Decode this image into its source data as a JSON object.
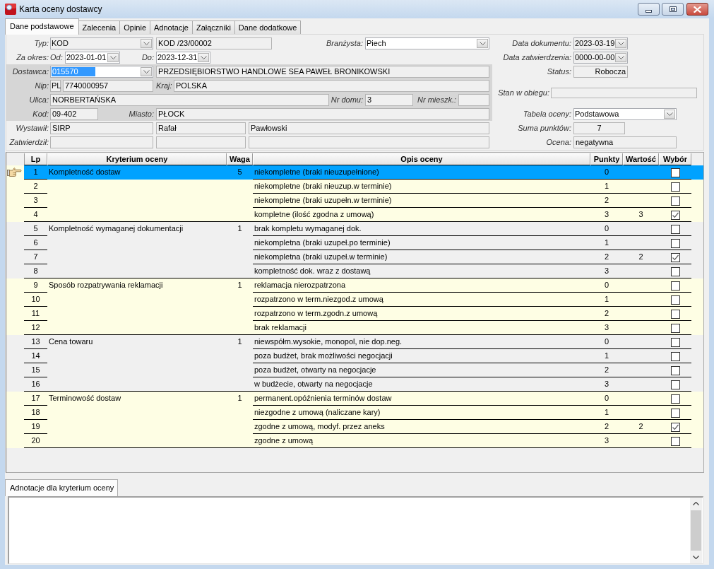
{
  "window": {
    "title": "Karta oceny dostawcy"
  },
  "tabs": [
    {
      "label": "Dane podstawowe",
      "selected": true
    },
    {
      "label": "Zalecenia",
      "selected": false
    },
    {
      "label": "Opinie",
      "selected": false
    },
    {
      "label": "Adnotacje",
      "selected": false
    },
    {
      "label": "Załączniki",
      "selected": false
    },
    {
      "label": "Dane dodatkowe",
      "selected": false
    }
  ],
  "document": {
    "type": {
      "label": "Typ:",
      "value": "KOD",
      "disabled": true
    },
    "number": "KOD /23/00002",
    "buyer": {
      "label": "Branżysta:",
      "value": "Piech",
      "disabled": false
    },
    "period": {
      "label": "Za okres:",
      "from_label": "Od:",
      "from": {
        "value": "2023-01-01",
        "disabled": false
      },
      "to_label": "Do:",
      "to": {
        "value": "2023-12-31",
        "disabled": false
      }
    }
  },
  "supplier": {
    "code": {
      "label": "Dostawca:",
      "value": "015570",
      "disabled": false,
      "text_selected": true
    },
    "name": "PRZEDSIĘBIORSTWO HANDLOWE SEA PAWEŁ BRONIKOWSKI",
    "nip": {
      "label": "Nip:",
      "prefix": "PL",
      "value": "7740000957"
    },
    "country": {
      "label": "Kraj:",
      "value": "POLSKA"
    },
    "street": {
      "label": "Ulica:",
      "value": "NORBERTAŃSKA"
    },
    "house_no": {
      "label": "Nr domu:",
      "value": "3"
    },
    "flat_no": {
      "label": "Nr mieszk.:"
    },
    "postal_code": {
      "label": "Kod:",
      "value": "09-402"
    },
    "city": {
      "label": "Miasto:",
      "value": "PŁOCK"
    }
  },
  "people": {
    "issued_by": {
      "label": "Wystawił:",
      "code": "SIRP",
      "first_name": "Rafał",
      "last_name": "Pawłowski"
    },
    "approved_by": {
      "label": "Zatwierdził:"
    }
  },
  "summary": {
    "doc_date": {
      "label": "Data dokumentu:",
      "value": "2023-03-19",
      "disabled": true
    },
    "approval_date": {
      "label": "Data zatwierdzenia:",
      "value": "0000-00-00",
      "disabled": true
    },
    "status": {
      "label": "Status:",
      "value": "Robocza"
    },
    "workflow_state": {
      "label": "Stan w obiegu:"
    },
    "rating_table": {
      "label": "Tabela oceny:",
      "value": "Podstawowa",
      "disabled": false
    },
    "points_sum": {
      "label": "Suma punktów:",
      "value": "7"
    },
    "rating": {
      "label": "Ocena:",
      "value": "negatywna"
    }
  },
  "criteria_table": {
    "columns": [
      "Lp",
      "Kryterium oceny",
      "Waga",
      "Opis oceny",
      "Punkty",
      "Wartość",
      "Wybór"
    ],
    "groups": [
      {
        "criterion": "Kompletność dostaw",
        "weight": "5",
        "rows": [
          {
            "lp": "1",
            "description": "niekompletne (braki nieuzupełnione)",
            "points": "0",
            "selected": true,
            "checked": false
          },
          {
            "lp": "2",
            "description": "niekompletne (braki nieuzup.w terminie)",
            "points": "1",
            "selected": false,
            "checked": false
          },
          {
            "lp": "3",
            "description": "niekompletne (braki uzupełn.w terminie)",
            "points": "2",
            "selected": false,
            "checked": false
          },
          {
            "lp": "4",
            "description": "kompletne (ilość zgodna z umową)",
            "points": "3",
            "value": "3",
            "selected": false,
            "checked": true
          }
        ]
      },
      {
        "criterion": "Kompletność wymaganej dokumentacji",
        "weight": "1",
        "rows": [
          {
            "lp": "5",
            "description": "brak kompletu wymaganej dok.",
            "points": "0",
            "selected": false,
            "checked": false
          },
          {
            "lp": "6",
            "description": "niekompletna (braki uzupeł.po terminie)",
            "points": "1",
            "selected": false,
            "checked": false
          },
          {
            "lp": "7",
            "description": "niekompletna (braki uzupeł.w terminie)",
            "points": "2",
            "value": "2",
            "selected": false,
            "checked": true
          },
          {
            "lp": "8",
            "description": "kompletność dok. wraz z dostawą",
            "points": "3",
            "selected": false,
            "checked": false
          }
        ]
      },
      {
        "criterion": "Sposób rozpatrywania reklamacji",
        "weight": "1",
        "rows": [
          {
            "lp": "9",
            "description": "reklamacja nierozpatrzona",
            "points": "0",
            "selected": false,
            "checked": false
          },
          {
            "lp": "10",
            "description": "rozpatrzono w term.niezgod.z umową",
            "points": "1",
            "selected": false,
            "checked": false
          },
          {
            "lp": "11",
            "description": "rozpatrzono w term.zgodn.z umową",
            "points": "2",
            "selected": false,
            "checked": false
          },
          {
            "lp": "12",
            "description": "brak reklamacji",
            "points": "3",
            "selected": false,
            "checked": false
          }
        ]
      },
      {
        "criterion": "Cena towaru",
        "weight": "1",
        "rows": [
          {
            "lp": "13",
            "description": "niewspółm.wysokie, monopol, nie dop.neg.",
            "points": "0",
            "selected": false,
            "checked": false
          },
          {
            "lp": "14",
            "description": "poza budżet, brak możliwości negocjacji",
            "points": "1",
            "selected": false,
            "checked": false
          },
          {
            "lp": "15",
            "description": "poza budżet, otwarty na negocjacje",
            "points": "2",
            "selected": false,
            "checked": false
          },
          {
            "lp": "16",
            "description": "w budżecie, otwarty na negocjacje",
            "points": "3",
            "selected": false,
            "checked": false
          }
        ]
      },
      {
        "criterion": "Terminowość dostaw",
        "weight": "1",
        "rows": [
          {
            "lp": "17",
            "description": "permanent.opóźnienia terminów dostaw",
            "points": "0",
            "selected": false,
            "checked": false
          },
          {
            "lp": "18",
            "description": "niezgodne z umową (naliczane kary)",
            "points": "1",
            "selected": false,
            "checked": false
          },
          {
            "lp": "19",
            "description": "zgodne z umową, modyf. przez aneks",
            "points": "2",
            "value": "2",
            "selected": false,
            "checked": true
          },
          {
            "lp": "20",
            "description": "zgodne z umową",
            "points": "3",
            "selected": false,
            "checked": false
          }
        ]
      }
    ]
  },
  "annotations": {
    "tab_label": "Adnotacje dla kryterium oceny"
  }
}
